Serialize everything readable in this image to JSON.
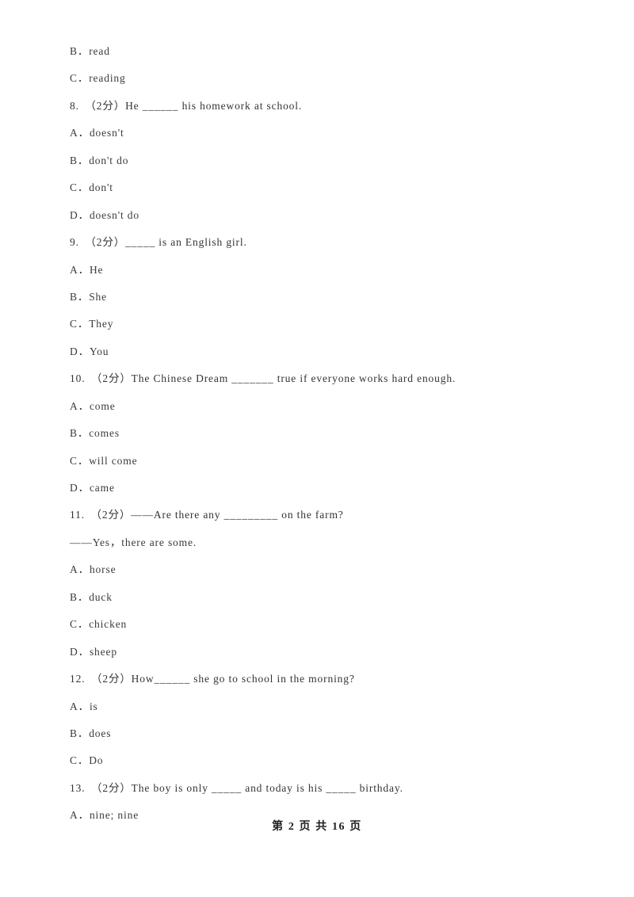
{
  "document": {
    "page_background": "#ffffff",
    "text_color": "#3a3a3a",
    "lines": [
      {
        "kind": "option",
        "text": "B．read"
      },
      {
        "kind": "option",
        "text": "C．reading"
      },
      {
        "kind": "question",
        "text": "8.　（2分）He ______ his homework at school."
      },
      {
        "kind": "option",
        "text": "A．doesn't"
      },
      {
        "kind": "option",
        "text": "B．don't do"
      },
      {
        "kind": "option",
        "text": "C．don't"
      },
      {
        "kind": "option",
        "text": "D．doesn't do"
      },
      {
        "kind": "question",
        "text": "9.　（2分）_____ is an English girl."
      },
      {
        "kind": "option",
        "text": "A．He"
      },
      {
        "kind": "option",
        "text": "B．She"
      },
      {
        "kind": "option",
        "text": "C．They"
      },
      {
        "kind": "option",
        "text": "D．You"
      },
      {
        "kind": "question",
        "text": "10.　（2分）The Chinese Dream _______ true if everyone works hard enough."
      },
      {
        "kind": "option",
        "text": "A．come"
      },
      {
        "kind": "option",
        "text": "B．comes"
      },
      {
        "kind": "option",
        "text": "C．will come"
      },
      {
        "kind": "option",
        "text": "D．came"
      },
      {
        "kind": "question",
        "text": "11.　（2分）——Are there any _________ on the farm?"
      },
      {
        "kind": "cont",
        "text": "——Yes，there are some."
      },
      {
        "kind": "option",
        "text": "A．horse"
      },
      {
        "kind": "option",
        "text": "B．duck"
      },
      {
        "kind": "option",
        "text": "C．chicken"
      },
      {
        "kind": "option",
        "text": "D．sheep"
      },
      {
        "kind": "question",
        "text": "12.　（2分）How______ she go to school in the morning?"
      },
      {
        "kind": "option",
        "text": "A．is"
      },
      {
        "kind": "option",
        "text": "B．does"
      },
      {
        "kind": "option",
        "text": "C．Do"
      },
      {
        "kind": "question",
        "text": "13.　（2分）The boy is only _____ and today is his _____ birthday."
      },
      {
        "kind": "option",
        "text": "A．nine; nine"
      }
    ],
    "footer": {
      "text": "第 2 页 共 16 页",
      "page_number": "2",
      "total_pages": "16"
    }
  }
}
